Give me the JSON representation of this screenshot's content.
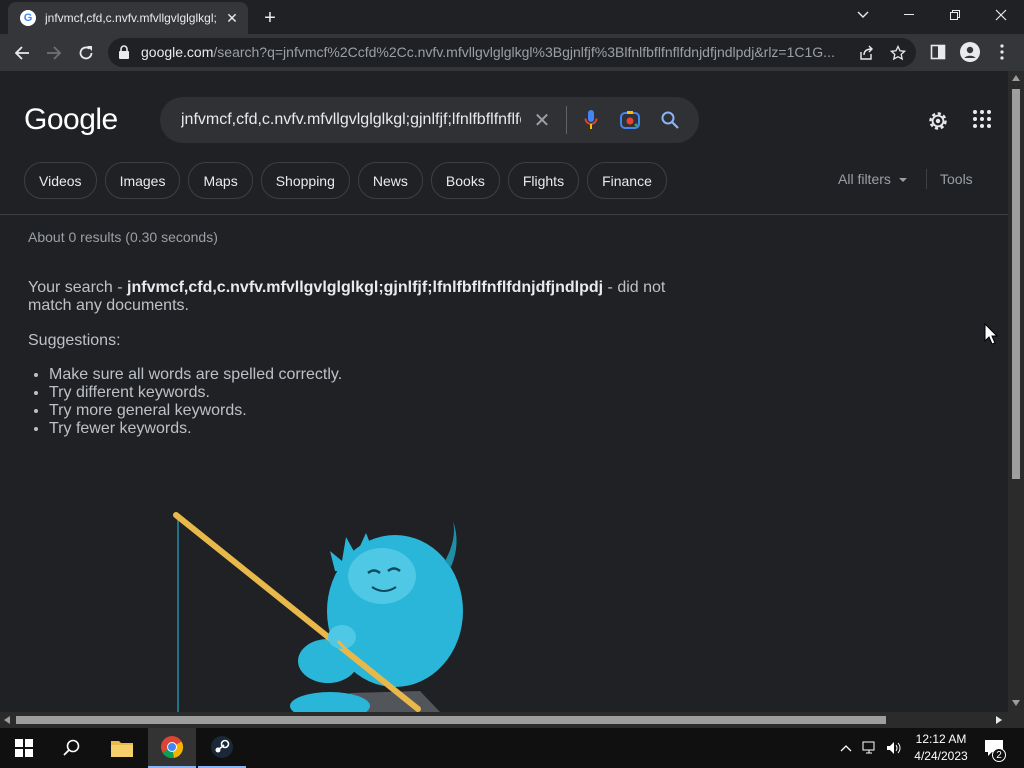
{
  "browser": {
    "tab_title": "jnfvmcf,cfd,c.nvfv.mfvllgvlglglkgl;",
    "favicon_letter": "G",
    "url_domain": "google.com",
    "url_rest": "/search?q=jnfvmcf%2Ccfd%2Cc.nvfv.mfvllgvlglglkgl%3Bgjnlfjf%3Blfnlfbflfnflfdnjdfjndlpdj&rlz=1C1G..."
  },
  "search": {
    "logo": "Google",
    "query": "jnfvmcf,cfd,c.nvfv.mfvllgvlglglkgl;gjnlfjf;lfnlfbflfnflfdnjdfjndlpdj",
    "chips": [
      "Videos",
      "Images",
      "Maps",
      "Shopping",
      "News",
      "Books",
      "Flights",
      "Finance"
    ],
    "all_filters": "All filters",
    "tools": "Tools"
  },
  "results": {
    "stats": "About 0 results (0.30 seconds)",
    "msg_prefix": "Your search - ",
    "msg_query": "jnfvmcf,cfd,c.nvfv.mfvllgvlglglkgl;gjnlfjf;lfnlfbflfnflfdnjdfjndlpdj",
    "msg_suffix": " - did not match any documents.",
    "suggestions_heading": "Suggestions:",
    "suggestions": [
      "Make sure all words are spelled correctly.",
      "Try different keywords.",
      "Try more general keywords.",
      "Try fewer keywords."
    ]
  },
  "taskbar": {
    "time": "12:12 AM",
    "date": "4/24/2023",
    "notifications": "2"
  },
  "colors": {
    "background": "#202124",
    "toolbar": "#35363a",
    "yeti": "#29b6d8",
    "rod": "#e8b84a"
  }
}
